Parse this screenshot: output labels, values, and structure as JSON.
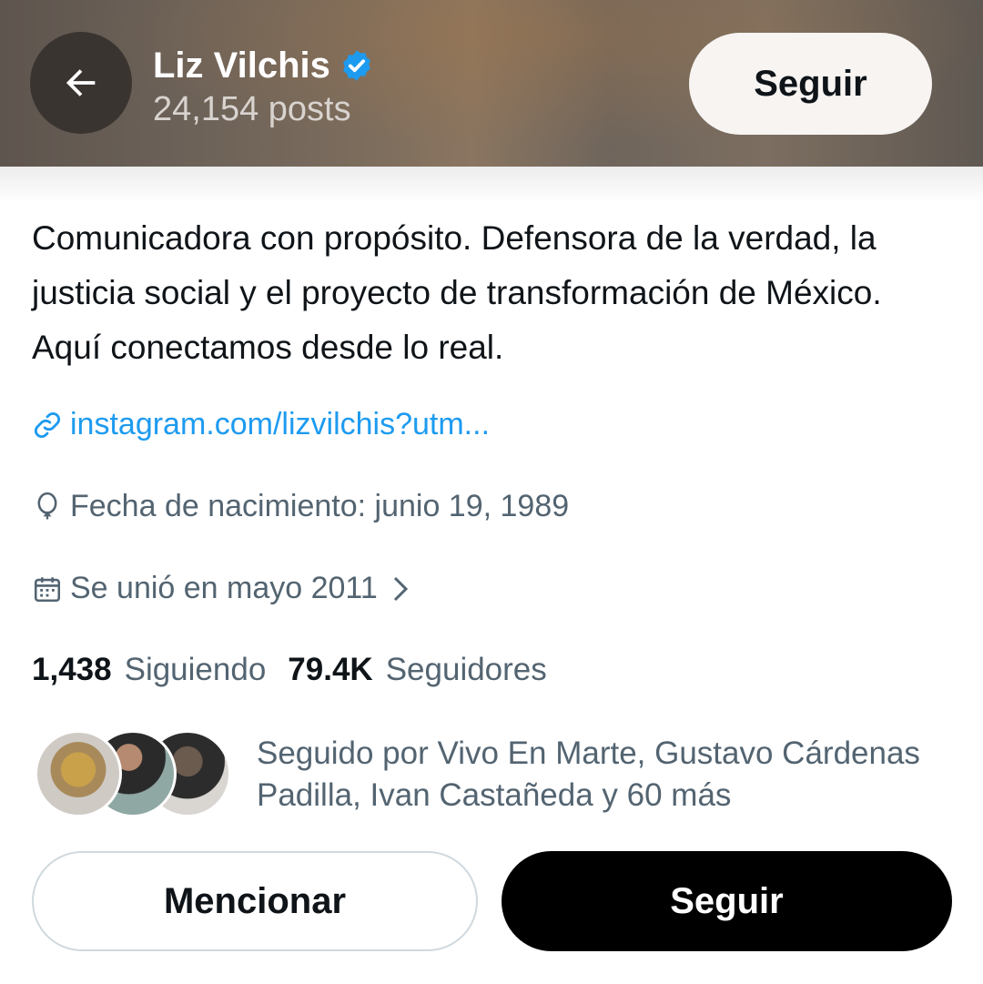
{
  "header": {
    "name": "Liz Vilchis",
    "posts": "24,154 posts",
    "follow_label": "Seguir",
    "back_icon": "arrow-left-icon",
    "verified_icon": "verified-badge-icon"
  },
  "profile": {
    "bio": "Comunicadora con propósito. Defensora de la verdad, la justicia social y el proyecto de transformación de México. Aquí conectamos desde lo real.",
    "link": "instagram.com/lizvilchis?utm...",
    "birthday": "Fecha de nacimiento: junio 19, 1989",
    "joined": "Se unió en mayo 2011",
    "following_count": "1,438",
    "following_label": "Siguiendo",
    "followers_count": "79.4K",
    "followers_label": "Seguidores",
    "followed_by": "Seguido por Vivo En Marte, Gustavo Cárdenas Padilla, Ivan Castañeda y 60 más"
  },
  "actions": {
    "mention_label": "Mencionar",
    "follow_label": "Seguir"
  },
  "colors": {
    "accent": "#1d9bf0",
    "secondary_text": "#536471",
    "primary_text": "#0f1419"
  }
}
